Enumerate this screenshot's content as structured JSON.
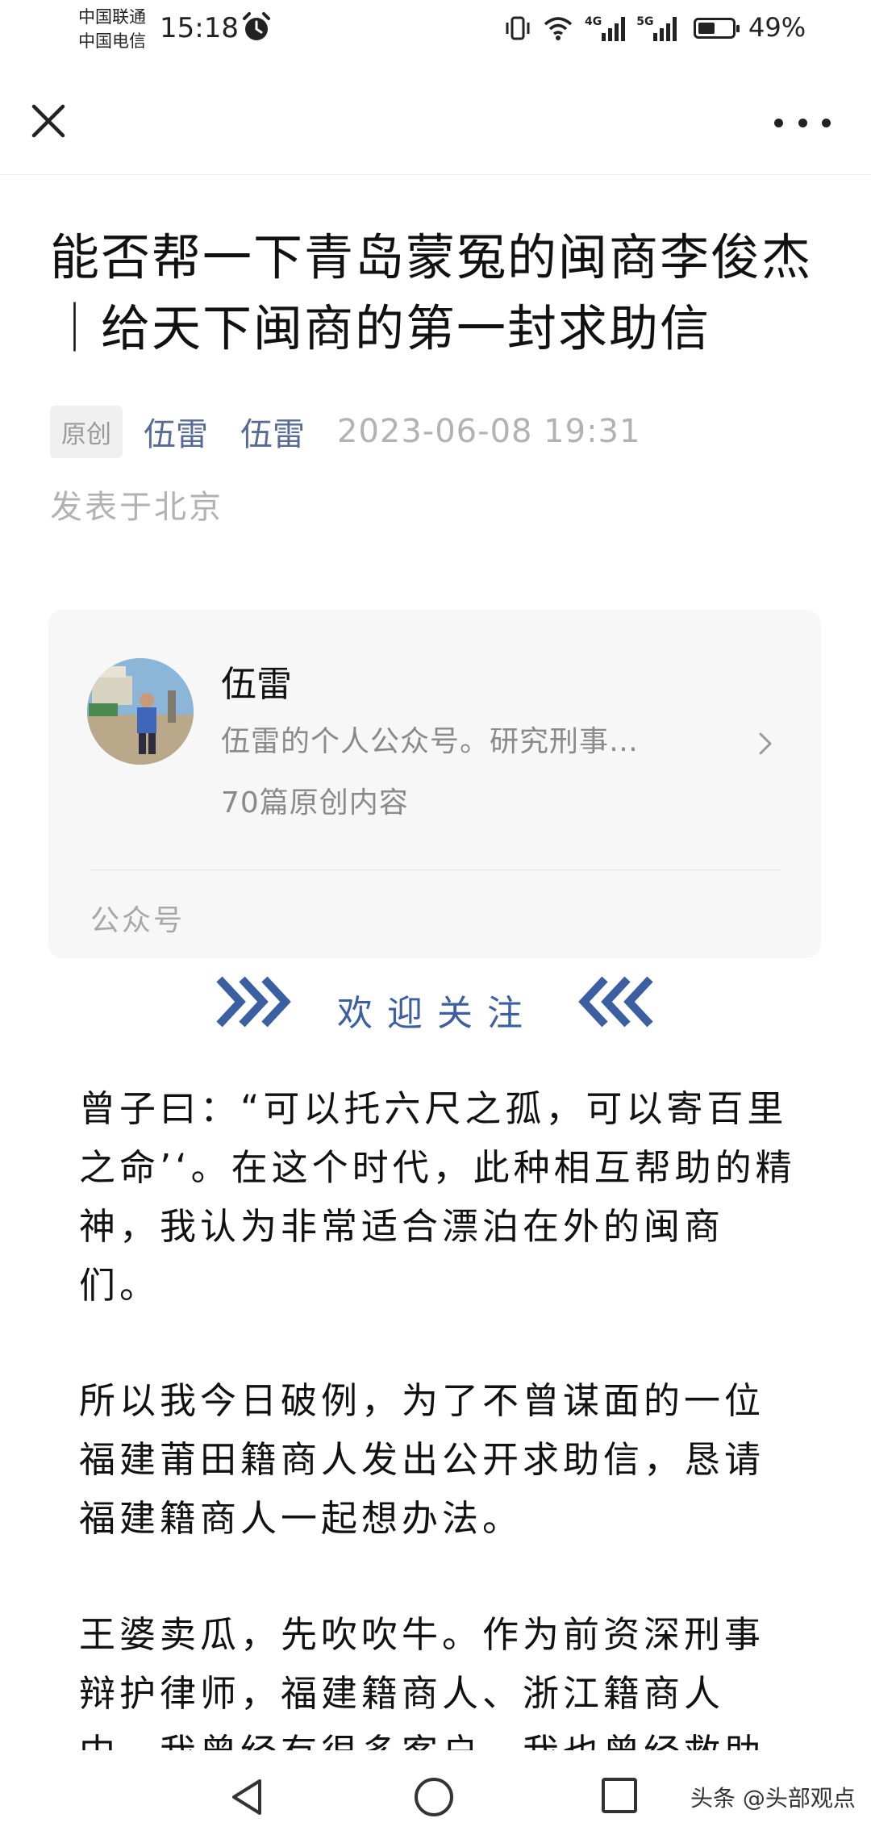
{
  "status_bar": {
    "carrier_1": "中国联通",
    "carrier_2": "中国电信",
    "time": "15:18",
    "network_1": "4G",
    "network_2": "5G",
    "battery": "49%",
    "icons": [
      "alarm-icon",
      "vibrate-icon",
      "wifi-icon",
      "signal-icon",
      "battery-icon"
    ]
  },
  "nav": {
    "close_icon": "close-icon",
    "more_icon": "more-icon"
  },
  "article": {
    "title": "能否帮一下青岛蒙冤的闽商李俊杰｜给天下闽商的第一封求助信",
    "original_tag": "原创",
    "author_1": "伍雷",
    "author_2": "伍雷",
    "publish_time": "2023-06-08 19:31",
    "location": "发表于北京",
    "paragraphs": [
      "曾子曰：“可以托六尺之孤，可以寄百里之命’‘。在这个时代，此种相互帮助的精神，我认为非常适合漂泊在外的闽商们。",
      "所以我今日破例，为了不曾谋面的一位福建莆田籍商人发出公开求助信，恳请福建籍商人一起想办法。",
      "王婆卖瓜，先吹吹牛。作为前资深刑事辩护律师，福建籍商人、浙江籍商人中，我曾经有很多客户，我也曾经救助过多"
    ]
  },
  "account_card": {
    "name": "伍雷",
    "description": "伍雷的个人公众号。研究刑事…",
    "count": "70篇原创内容",
    "type": "公众号"
  },
  "follow_banner": {
    "text": "欢迎关注",
    "color": "#3b5fa1"
  },
  "system_nav": {
    "watermark": "头条 @头部观点"
  },
  "colors": {
    "link": "#576b95",
    "meta_gray": "#b2b2b2",
    "card_bg": "#f7f7f7"
  }
}
